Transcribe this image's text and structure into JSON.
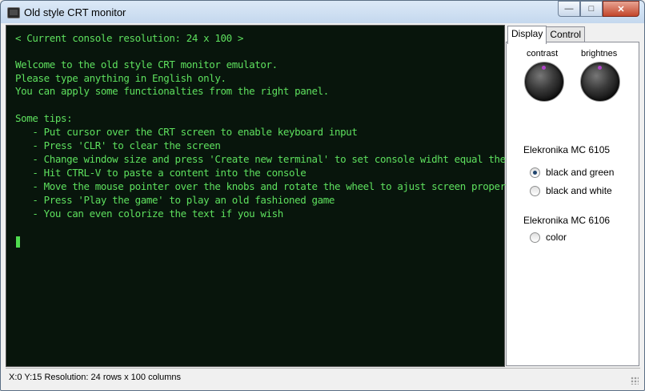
{
  "window": {
    "title": "Old style CRT monitor",
    "buttons": {
      "minimize": "—",
      "maximize": "□",
      "close": "✕"
    }
  },
  "crt": {
    "lines": [
      "< Current console resolution: 24 x 100 >",
      "",
      "Welcome to the old style CRT monitor emulator.",
      "Please type anything in English only.",
      "You can apply some functionalties from the right panel.",
      "",
      "Some tips:",
      "   - Put cursor over the CRT screen to enable keyboard input",
      "   - Press 'CLR' to clear the screen",
      "   - Change window size and press 'Create new terminal' to set console widht equal the window",
      "   - Hit CTRL-V to paste a content into the console",
      "   - Move the mouse pointer over the knobs and rotate the wheel to ajust screen properties",
      "   - Press 'Play the game' to play an old fashioned game",
      "   - You can even colorize the text if you wish"
    ],
    "text_color": "#5ee05e",
    "background": "#08150c"
  },
  "panel": {
    "tabs": [
      {
        "label": "Display",
        "active": true
      },
      {
        "label": "Control",
        "active": false
      }
    ],
    "knobs": {
      "contrast": "contrast",
      "brightness": "brightnes"
    },
    "group1": {
      "title": "Elekronika MC 6105",
      "options": [
        {
          "label": "black and green",
          "checked": true
        },
        {
          "label": "black and white",
          "checked": false
        }
      ]
    },
    "group2": {
      "title": "Elekronika MC 6106",
      "options": [
        {
          "label": "color",
          "checked": false
        }
      ]
    }
  },
  "status": {
    "text": "X:0 Y:15 Resolution: 24 rows x 100 columns"
  }
}
